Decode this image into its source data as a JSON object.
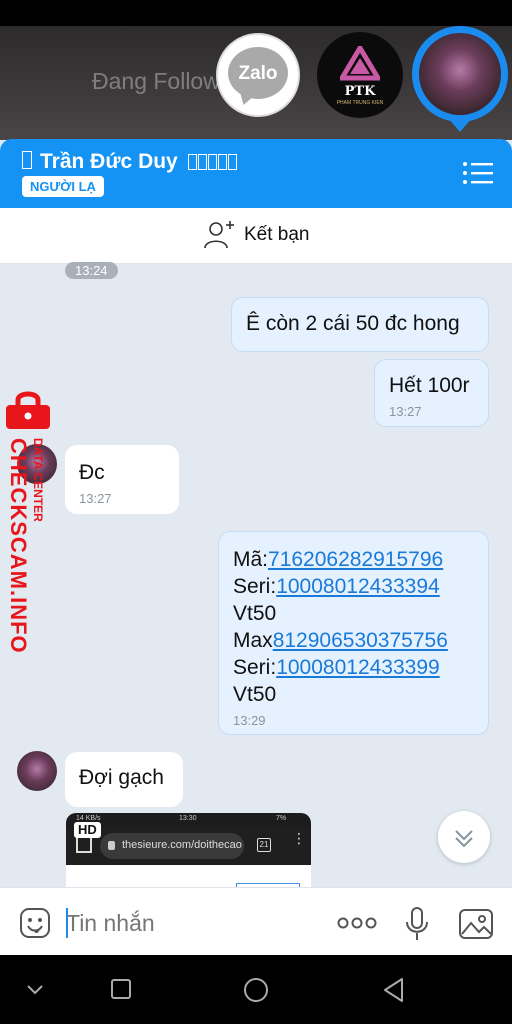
{
  "background": {
    "obscured_text": "Đang Follow"
  },
  "chat_heads": [
    {
      "name": "Zalo",
      "label": "Zalo"
    },
    {
      "name": "PTK",
      "label": "PTK",
      "sublabel": "PHAM TRUNG KIEN"
    },
    {
      "name": "active-contact"
    }
  ],
  "header": {
    "title": "Trần Đức Duy",
    "badge": "NGƯỜI LẠ",
    "accent": "#1493f4"
  },
  "add_friend": {
    "label": "Kết bạn"
  },
  "messages": {
    "time_pill": "13:24",
    "m1": {
      "text": "Ê còn 2 cái 50 đc hong"
    },
    "m2": {
      "text": "Hết 100r",
      "time": "13:27"
    },
    "m3": {
      "text": "Đc",
      "time": "13:27"
    },
    "m4": {
      "line1_label": "Mã:",
      "line1_link": "716206282915796",
      "line2_label": "Seri:",
      "line2_link": "10008012433394",
      "line3": "Vt50",
      "line4_label": "Max",
      "line4_link": "812906530375756",
      "line5_label": "Seri:",
      "line5_link": "10008012433399",
      "line6": "Vt50",
      "time": "13:29"
    },
    "m5": {
      "text": "Đợi gạch"
    }
  },
  "watermark": {
    "main": "CHECKSCAM.INFO",
    "sub": "DATA CENTER"
  },
  "screenshot_preview": {
    "hd_badge": "HD",
    "status_left": "14 KB/s",
    "status_time": "13:30",
    "status_right": "7%",
    "url": "thesieure.com/doithecao",
    "tab_count": "21"
  },
  "input": {
    "placeholder": "Tin nhắn"
  },
  "icons": {
    "emoji": "emoji-icon",
    "more": "more-icon",
    "mic": "mic-icon",
    "image": "image-icon",
    "add_friend": "add-friend-icon",
    "menu": "menu-icon",
    "scroll_down": "chevron-down-icon"
  }
}
